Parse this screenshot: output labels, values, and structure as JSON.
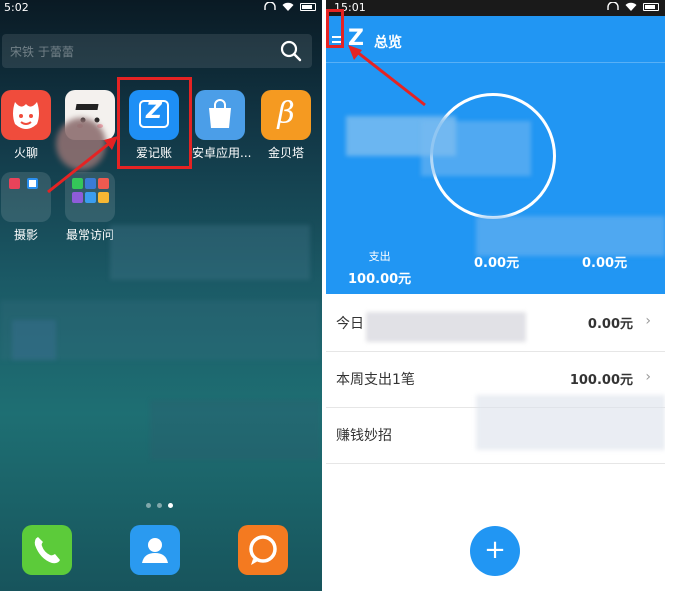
{
  "left_phone": {
    "status": {
      "time": "5:02"
    },
    "search": {
      "placeholder": "宋铁 于蕾蕾"
    },
    "apps": [
      {
        "label": "火聊"
      },
      {
        "label": ""
      },
      {
        "label": "爱记账"
      },
      {
        "label": "安卓应用..."
      },
      {
        "label": "金贝塔"
      }
    ],
    "row2": [
      {
        "label": "摄影"
      },
      {
        "label": "最常访问"
      }
    ],
    "jinbei_glyph": "β",
    "aijizhang_glyph": "Z"
  },
  "right_phone": {
    "status": {
      "time": "15:01"
    },
    "header": {
      "title": "总览",
      "logo": "Z"
    },
    "stats": [
      {
        "key": "支出",
        "value": "100.00元"
      },
      {
        "key": "",
        "value": "0.00元"
      },
      {
        "key": "",
        "value": "0.00元"
      }
    ],
    "rows": [
      {
        "label": "今日",
        "value": "0.00元",
        "chev": "›"
      },
      {
        "label": "本周支出1笔",
        "value": "100.00元",
        "chev": "›"
      },
      {
        "label": "赚钱妙招",
        "value": "",
        "chev": ""
      }
    ],
    "fab": {
      "label": "+"
    }
  },
  "colors": {
    "accent_blue": "#2196f3",
    "highlight_red": "#e52323"
  }
}
